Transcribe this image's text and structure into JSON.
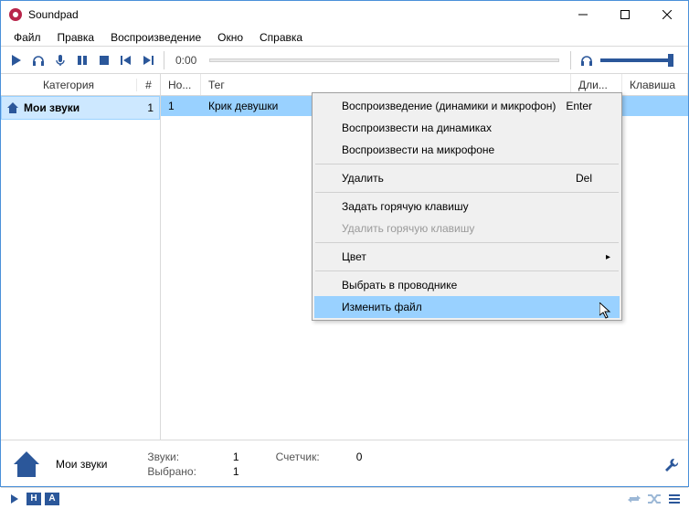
{
  "window": {
    "title": "Soundpad"
  },
  "menu": {
    "file": "Файл",
    "edit": "Правка",
    "playback": "Воспроизведение",
    "window": "Окно",
    "help": "Справка"
  },
  "toolbar": {
    "time": "0:00"
  },
  "sidebar": {
    "col_category": "Категория",
    "col_count": "#",
    "items": [
      {
        "label": "Мои звуки",
        "count": "1"
      }
    ]
  },
  "table": {
    "col_num": "Но...",
    "col_tag": "Тег",
    "col_dur": "Дли...",
    "col_key": "Клавиша",
    "rows": [
      {
        "num": "1",
        "tag": "Крик девушки"
      }
    ]
  },
  "context_menu": {
    "play_both": "Воспроизведение (динамики и микрофон)",
    "play_both_key": "Enter",
    "play_speakers": "Воспроизвести на динамиках",
    "play_mic": "Воспроизвести на микрофоне",
    "delete": "Удалить",
    "delete_key": "Del",
    "set_hotkey": "Задать горячую клавишу",
    "remove_hotkey": "Удалить горячую клавишу",
    "color": "Цвет",
    "show_explorer": "Выбрать в проводнике",
    "change_file": "Изменить файл"
  },
  "status": {
    "category": "Мои звуки",
    "sounds_label": "Звуки:",
    "sounds_val": "1",
    "counter_label": "Счетчик:",
    "counter_val": "0",
    "selected_label": "Выбрано:",
    "selected_val": "1"
  },
  "bottom": {
    "h": "Н",
    "a": "А"
  }
}
